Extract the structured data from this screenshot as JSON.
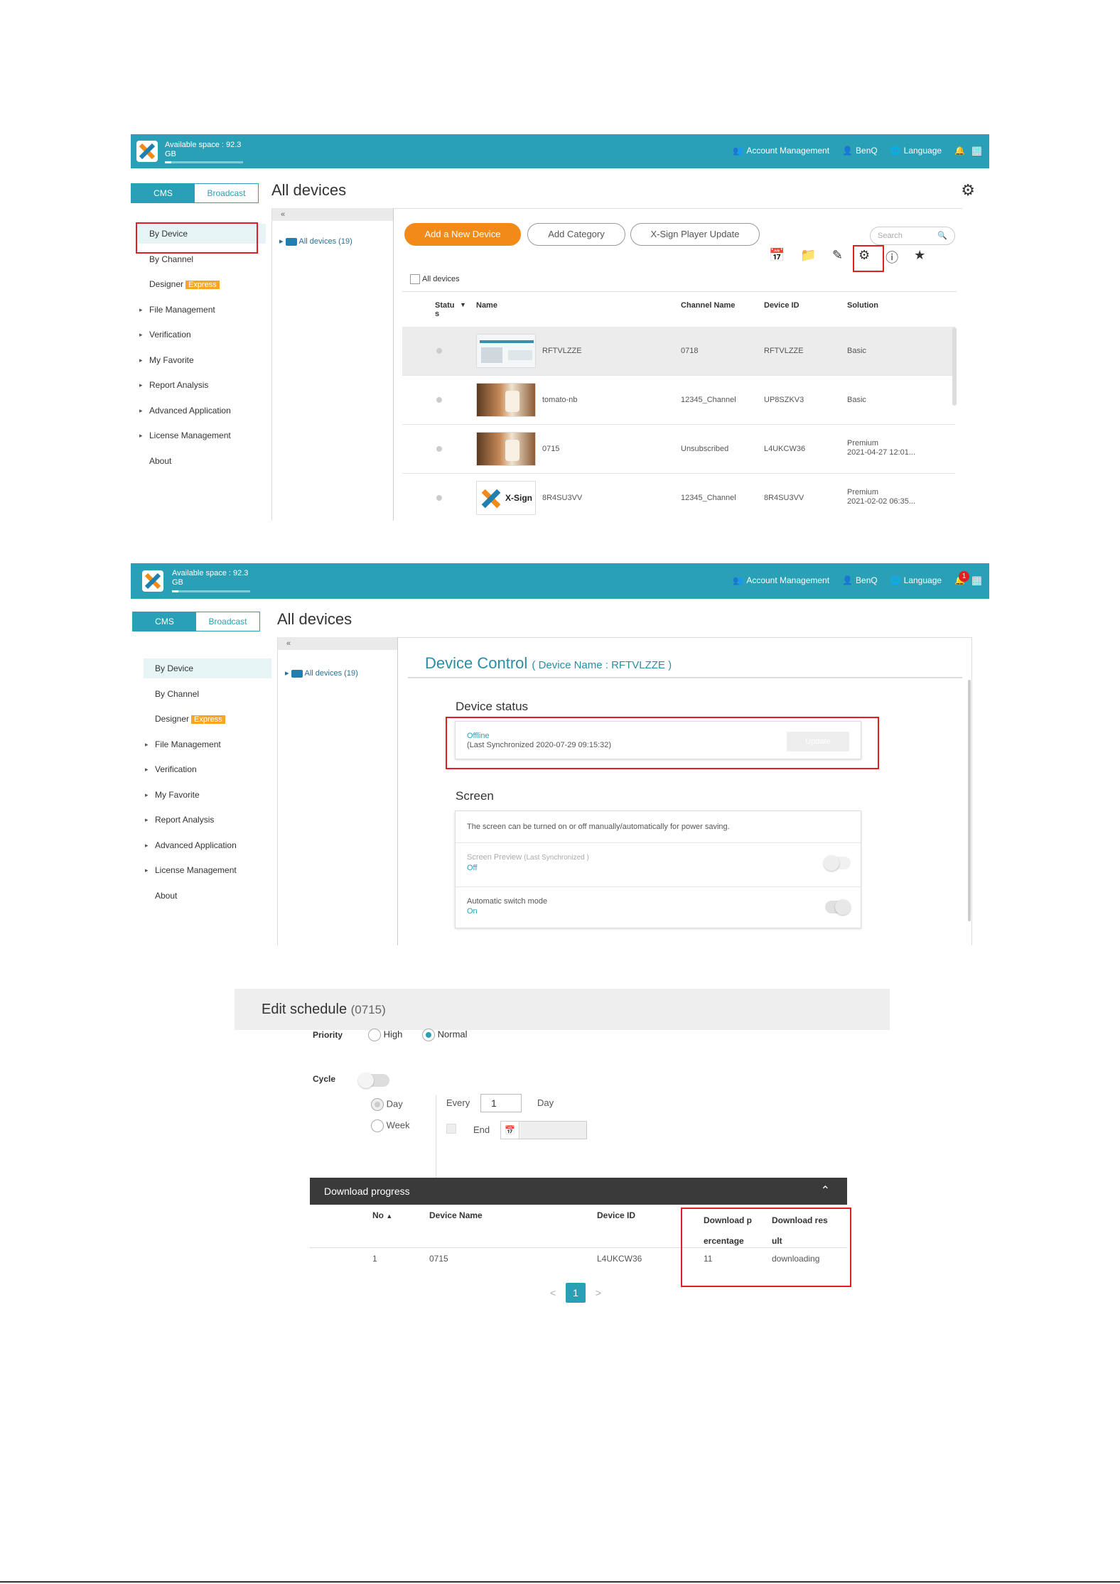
{
  "app": {
    "available_space": "Available space : 92.3",
    "available_unit": "GB",
    "account_management": "Account Management",
    "user": "BenQ",
    "language": "Language",
    "notification_count": "1"
  },
  "tabs": {
    "cms": "CMS",
    "broadcast": "Broadcast"
  },
  "page_title": "All devices",
  "sidebar": {
    "items": [
      {
        "label": "By Device",
        "arrow": false
      },
      {
        "label": "By Channel",
        "arrow": false
      },
      {
        "label": "Designer",
        "arrow": false,
        "badge": "Express"
      },
      {
        "label": "File Management",
        "arrow": true
      },
      {
        "label": "Verification",
        "arrow": true
      },
      {
        "label": "My Favorite",
        "arrow": true
      },
      {
        "label": "Report Analysis",
        "arrow": true
      },
      {
        "label": "Advanced Application",
        "arrow": true
      },
      {
        "label": "License Management",
        "arrow": true
      },
      {
        "label": "About",
        "arrow": false
      }
    ]
  },
  "tree": {
    "collapse": "«",
    "root": "All devices (19)"
  },
  "panel1": {
    "buttons": {
      "add_device": "Add a New Device",
      "add_category": "Add Category",
      "player_update": "X-Sign Player Update"
    },
    "search_placeholder": "Search",
    "all_devices_check": "All devices",
    "columns": {
      "status": "Statu s",
      "name": "Name",
      "channel": "Channel Name",
      "device_id": "Device ID",
      "solution": "Solution"
    },
    "rows": [
      {
        "name": "RFTVLZZE",
        "channel": "0718",
        "device_id": "RFTVLZZE",
        "solution": "Basic",
        "solution2": ""
      },
      {
        "name": "tomato-nb",
        "channel": "12345_Channel",
        "device_id": "UP8SZKV3",
        "solution": "Basic",
        "solution2": ""
      },
      {
        "name": "0715",
        "channel": "Unsubscribed",
        "device_id": "L4UKCW36",
        "solution": "Premium",
        "solution2": "2021-04-27 12:01..."
      },
      {
        "name": "8R4SU3VV",
        "channel": "12345_Channel",
        "device_id": "8R4SU3VV",
        "solution": "Premium",
        "solution2": "2021-02-02 06:35..."
      }
    ],
    "xsign_logo_text": "X-Sign"
  },
  "panel2": {
    "title": "Device Control",
    "device_name": "( Device Name : RFTVLZZE )",
    "device_status_title": "Device status",
    "status_value": "Offline",
    "status_sync": "(Last Synchronized 2020-07-29 09:15:32)",
    "update_button": "Update",
    "screen_title": "Screen",
    "screen_desc": "The screen can be turned on or off manually/automatically for power saving.",
    "preview_label": "Screen Preview",
    "preview_sync": "(Last Synchronized )",
    "preview_value": "Off",
    "auto_label": "Automatic switch mode",
    "auto_value": "On"
  },
  "panel3": {
    "title": "Edit schedule",
    "title_id": "(0715)",
    "priority_label": "Priority",
    "priority_high": "High",
    "priority_normal": "Normal",
    "cycle_label": "Cycle",
    "day": "Day",
    "week": "Week",
    "every": "Every",
    "every_value": "1",
    "every_unit": "Day",
    "end": "End",
    "download_progress": "Download progress",
    "columns": {
      "no": "No",
      "device_name": "Device Name",
      "device_id": "Device ID",
      "dl_pct_1": "Download p",
      "dl_pct_2": "ercentage",
      "dl_res_1": "Download res",
      "dl_res_2": "ult"
    },
    "row": {
      "no": "1",
      "device_name": "0715",
      "device_id": "L4UKCW36",
      "pct": "11",
      "result": "downloading"
    },
    "pager": {
      "prev": "<",
      "page": "1",
      "next": ">"
    }
  },
  "colors": {
    "accent": "#2aa0b6",
    "orange": "#f28a1a",
    "highlight_red": "#e02020"
  }
}
